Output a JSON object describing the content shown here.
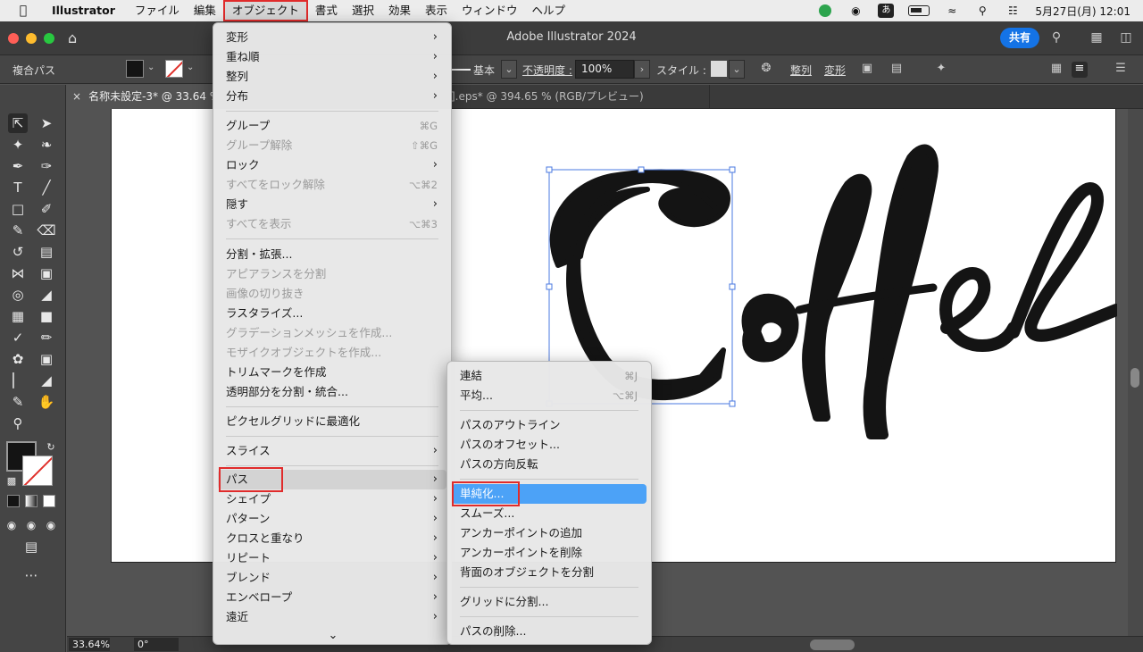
{
  "menubar": {
    "apple_icon": "apple-icon",
    "app": "Illustrator",
    "items": [
      "ファイル",
      "編集",
      "オブジェクト",
      "書式",
      "選択",
      "効果",
      "表示",
      "ウィンドウ",
      "ヘルプ"
    ],
    "ime": "あ",
    "datetime": "5月27日(月)  12:01"
  },
  "titlebar": {
    "title": "Adobe Illustrator 2024",
    "share": "共有"
  },
  "controlbar": {
    "selection_label": "複合パス",
    "stroke_profile": "基本",
    "opacity_label": "不透明度 :",
    "opacity_value": "100%",
    "style_label": "スタイル :",
    "align_label": "整列",
    "transform_label": "変形"
  },
  "tabs": {
    "tab1": "名称未設定-3* @ 33.64 % (",
    "tab2": "].eps* @ 394.65 % (RGB/プレビュー)",
    "close": "×"
  },
  "statusbar": {
    "zoom": "33.64%",
    "rotation": "0°"
  },
  "object_menu": {
    "items": [
      {
        "label": "変形",
        "shortcut": "",
        "submenu": true,
        "enabled": true
      },
      {
        "label": "重ね順",
        "shortcut": "",
        "submenu": true,
        "enabled": true
      },
      {
        "label": "整列",
        "shortcut": "",
        "submenu": true,
        "enabled": true
      },
      {
        "label": "分布",
        "shortcut": "",
        "submenu": true,
        "enabled": true
      },
      {
        "label": "グループ",
        "shortcut": "⌘G",
        "submenu": false,
        "enabled": true
      },
      {
        "label": "グループ解除",
        "shortcut": "⇧⌘G",
        "submenu": false,
        "enabled": false
      },
      {
        "label": "ロック",
        "shortcut": "",
        "submenu": true,
        "enabled": true
      },
      {
        "label": "すべてをロック解除",
        "shortcut": "⌥⌘2",
        "submenu": false,
        "enabled": false
      },
      {
        "label": "隠す",
        "shortcut": "",
        "submenu": true,
        "enabled": true
      },
      {
        "label": "すべてを表示",
        "shortcut": "⌥⌘3",
        "submenu": false,
        "enabled": false
      },
      {
        "label": "分割・拡張...",
        "shortcut": "",
        "submenu": false,
        "enabled": true
      },
      {
        "label": "アピアランスを分割",
        "shortcut": "",
        "submenu": false,
        "enabled": false
      },
      {
        "label": "画像の切り抜き",
        "shortcut": "",
        "submenu": false,
        "enabled": false
      },
      {
        "label": "ラスタライズ...",
        "shortcut": "",
        "submenu": false,
        "enabled": true
      },
      {
        "label": "グラデーションメッシュを作成...",
        "shortcut": "",
        "submenu": false,
        "enabled": false
      },
      {
        "label": "モザイクオブジェクトを作成...",
        "shortcut": "",
        "submenu": false,
        "enabled": false
      },
      {
        "label": "トリムマークを作成",
        "shortcut": "",
        "submenu": false,
        "enabled": true
      },
      {
        "label": "透明部分を分割・統合...",
        "shortcut": "",
        "submenu": false,
        "enabled": true
      },
      {
        "label": "ピクセルグリッドに最適化",
        "shortcut": "",
        "submenu": false,
        "enabled": true
      },
      {
        "label": "スライス",
        "shortcut": "",
        "submenu": true,
        "enabled": true
      },
      {
        "label": "パス",
        "shortcut": "",
        "submenu": true,
        "enabled": true
      },
      {
        "label": "シェイプ",
        "shortcut": "",
        "submenu": true,
        "enabled": true
      },
      {
        "label": "パターン",
        "shortcut": "",
        "submenu": true,
        "enabled": true
      },
      {
        "label": "クロスと重なり",
        "shortcut": "",
        "submenu": true,
        "enabled": true
      },
      {
        "label": "リピート",
        "shortcut": "",
        "submenu": true,
        "enabled": true
      },
      {
        "label": "ブレンド",
        "shortcut": "",
        "submenu": true,
        "enabled": true
      },
      {
        "label": "エンベロープ",
        "shortcut": "",
        "submenu": true,
        "enabled": true
      },
      {
        "label": "遠近",
        "shortcut": "",
        "submenu": true,
        "enabled": true
      }
    ],
    "more_icon": "chevron-down-icon"
  },
  "path_menu": {
    "items": [
      {
        "label": "連結",
        "shortcut": "⌘J"
      },
      {
        "label": "平均...",
        "shortcut": "⌥⌘J"
      },
      {
        "label": "パスのアウトライン",
        "shortcut": ""
      },
      {
        "label": "パスのオフセット...",
        "shortcut": ""
      },
      {
        "label": "パスの方向反転",
        "shortcut": ""
      },
      {
        "label": "単純化...",
        "shortcut": ""
      },
      {
        "label": "スムーズ...",
        "shortcut": ""
      },
      {
        "label": "アンカーポイントの追加",
        "shortcut": ""
      },
      {
        "label": "アンカーポイントを削除",
        "shortcut": ""
      },
      {
        "label": "背面のオブジェクトを分割",
        "shortcut": ""
      },
      {
        "label": "グリッドに分割...",
        "shortcut": ""
      },
      {
        "label": "パスの削除...",
        "shortcut": ""
      }
    ]
  },
  "colors": {
    "accent": "#1473e6",
    "highlight_blue": "#4ca2f7",
    "annotation_red": "#e02b2b"
  }
}
